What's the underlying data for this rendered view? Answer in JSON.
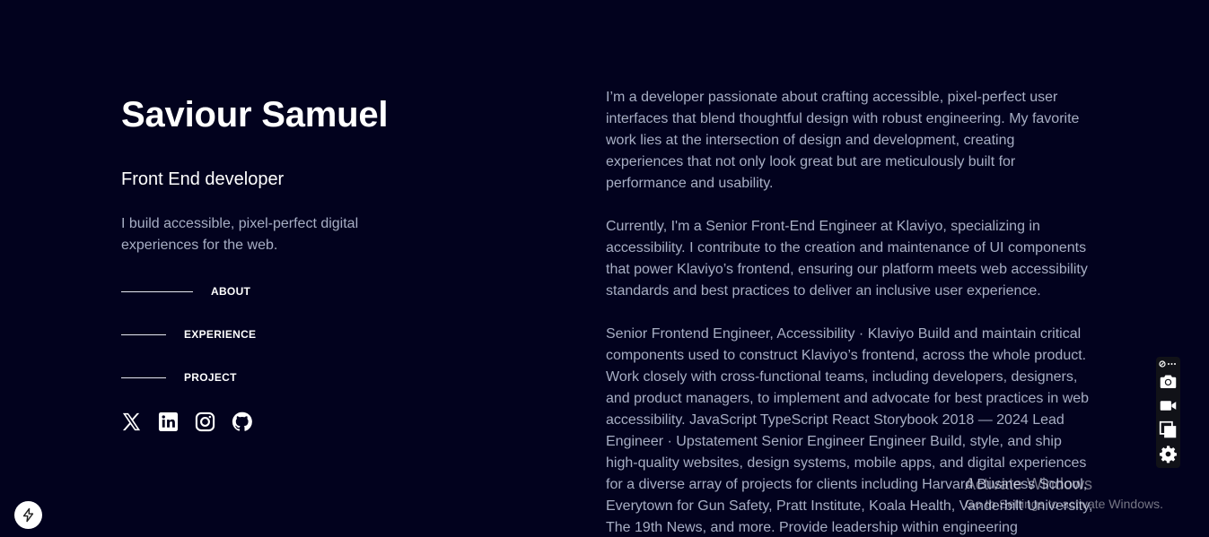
{
  "profile": {
    "name": "Saviour Samuel",
    "role": "Front End developer",
    "tagline": "I build accessible, pixel-perfect digital experiences for the web."
  },
  "nav": {
    "items": [
      {
        "label": "ABOUT",
        "active": true
      },
      {
        "label": "EXPERIENCE",
        "active": false
      },
      {
        "label": "PROJECT",
        "active": false
      }
    ]
  },
  "socials": {
    "items": [
      {
        "icon": "x-twitter-icon"
      },
      {
        "icon": "linkedin-icon"
      },
      {
        "icon": "instagram-icon"
      },
      {
        "icon": "github-icon"
      }
    ]
  },
  "about": {
    "paragraphs": [
      "I’m a developer passionate about crafting accessible, pixel-perfect user interfaces that blend thoughtful design with robust engineering. My favorite work lies at the intersection of design and development, creating experiences that not only look great but are meticulously built for performance and usability.",
      "Currently, I'm a Senior Front-End Engineer at Klaviyo, specializing in accessibility. I contribute to the creation and maintenance of UI components that power Klaviyo’s frontend, ensuring our platform meets web accessibility standards and best practices to deliver an inclusive user experience.",
      "Senior Frontend Engineer, Accessibility · Klaviyo Build and maintain critical components used to construct Klaviyo’s frontend, across the whole product. Work closely with cross-functional teams, including developers, designers, and product managers, to implement and advocate for best practices in web accessibility. JavaScript TypeScript React Storybook 2018 — 2024 Lead Engineer · Upstatement Senior Engineer Engineer Build, style, and ship high-quality websites, design systems, mobile apps, and digital experiences for a diverse array of projects for clients including Harvard Business School, Everytown for Gun Safety, Pratt Institute, Koala Health, Vanderbilt University, The 19th News, and more. Provide leadership within engineering"
    ]
  },
  "toolbar": {
    "buttons": [
      "camera-icon",
      "video-camera-icon",
      "copy-window-icon",
      "gear-icon"
    ]
  },
  "watermark": {
    "title": "Activate Windows",
    "subtitle": "Go to Settings to activate Windows."
  },
  "colors": {
    "background": "#02021e",
    "text_primary": "#ffffff",
    "text_muted": "#a7aec4"
  }
}
